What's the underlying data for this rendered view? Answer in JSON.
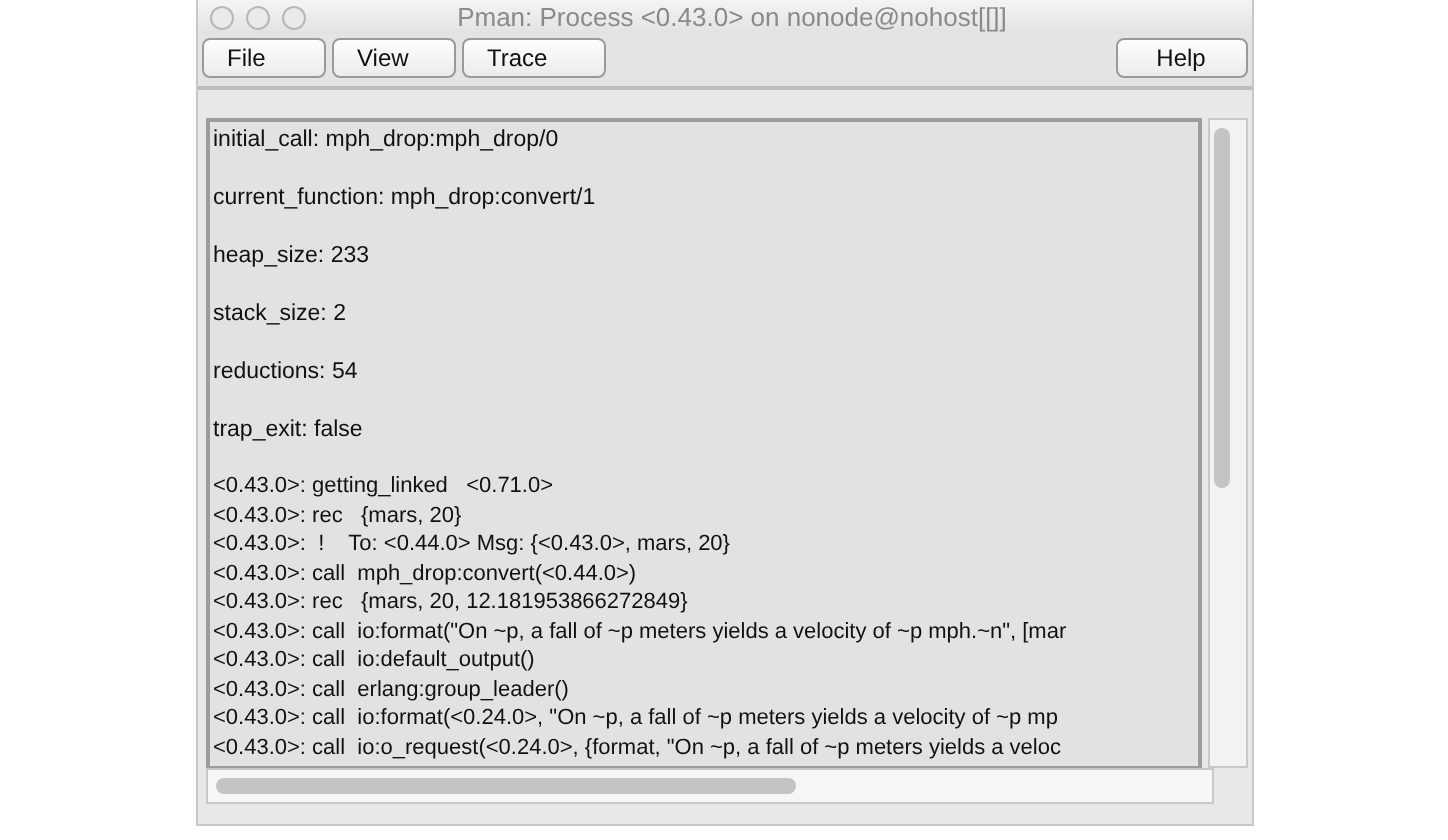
{
  "window": {
    "title": "Pman: Process <0.43.0> on nonode@nohost[[]]"
  },
  "menu": [
    "File",
    "View",
    "Trace"
  ],
  "help_menu": "Help",
  "info": [
    "initial_call: mph_drop:mph_drop/0",
    "current_function: mph_drop:convert/1",
    "heap_size: 233",
    "stack_size: 2",
    "reductions: 54",
    "trap_exit: false"
  ],
  "trace": [
    "<0.43.0>: getting_linked   <0.71.0>",
    "<0.43.0>: rec   {mars, 20}",
    "<0.43.0>:  !    To: <0.44.0> Msg: {<0.43.0>, mars, 20}",
    "<0.43.0>: call  mph_drop:convert(<0.44.0>)",
    "<0.43.0>: rec   {mars, 20, 12.181953866272849}",
    "<0.43.0>: call  io:format(\"On ~p, a fall of ~p meters yields a velocity of ~p mph.~n\", [mar",
    "<0.43.0>: call  io:default_output()",
    "<0.43.0>: call  erlang:group_leader()",
    "<0.43.0>: call  io:format(<0.24.0>, \"On ~p, a fall of ~p meters yields a velocity of ~p mp",
    "<0.43.0>: call  io:o_request(<0.24.0>, {format, \"On ~p, a fall of ~p meters yields a veloc"
  ]
}
